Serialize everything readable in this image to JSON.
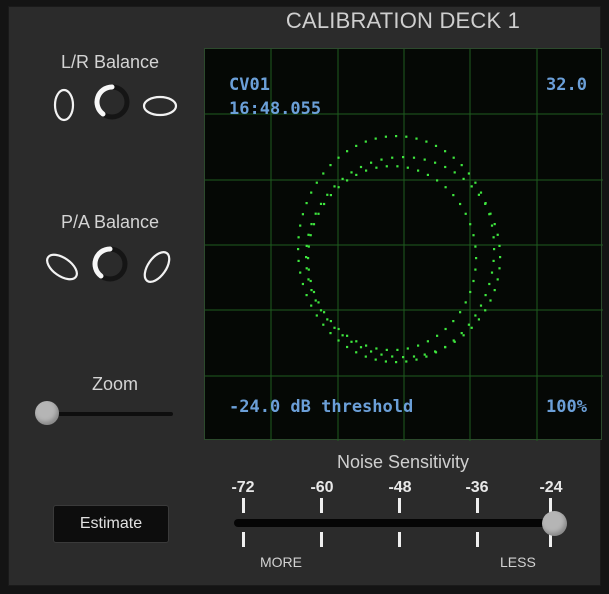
{
  "deck": {
    "title": "CALIBRATION DECK 1"
  },
  "controls": {
    "lr_balance": {
      "label": "L/R Balance"
    },
    "pa_balance": {
      "label": "P/A Balance"
    },
    "zoom": {
      "label": "Zoom",
      "level": 0
    },
    "estimate": {
      "label": "Estimate"
    }
  },
  "scope": {
    "channel": "CV01",
    "time": "16:48.055",
    "value": "32.0",
    "threshold": "-24.0 dB threshold",
    "percent": "100%",
    "grid_color": "#1f5c1f",
    "trace_color": "#3ee63e"
  },
  "noise_sensitivity": {
    "label": "Noise Sensitivity",
    "ticks": [
      "-72",
      "-60",
      "-48",
      "-36",
      "-24"
    ],
    "value": -24,
    "min_label": "MORE",
    "max_label": "LESS"
  },
  "colors": {
    "panel_bg": "#2b2b2b",
    "scope_text": "#6b9fd8",
    "thumb": "#b5b5b5"
  }
}
